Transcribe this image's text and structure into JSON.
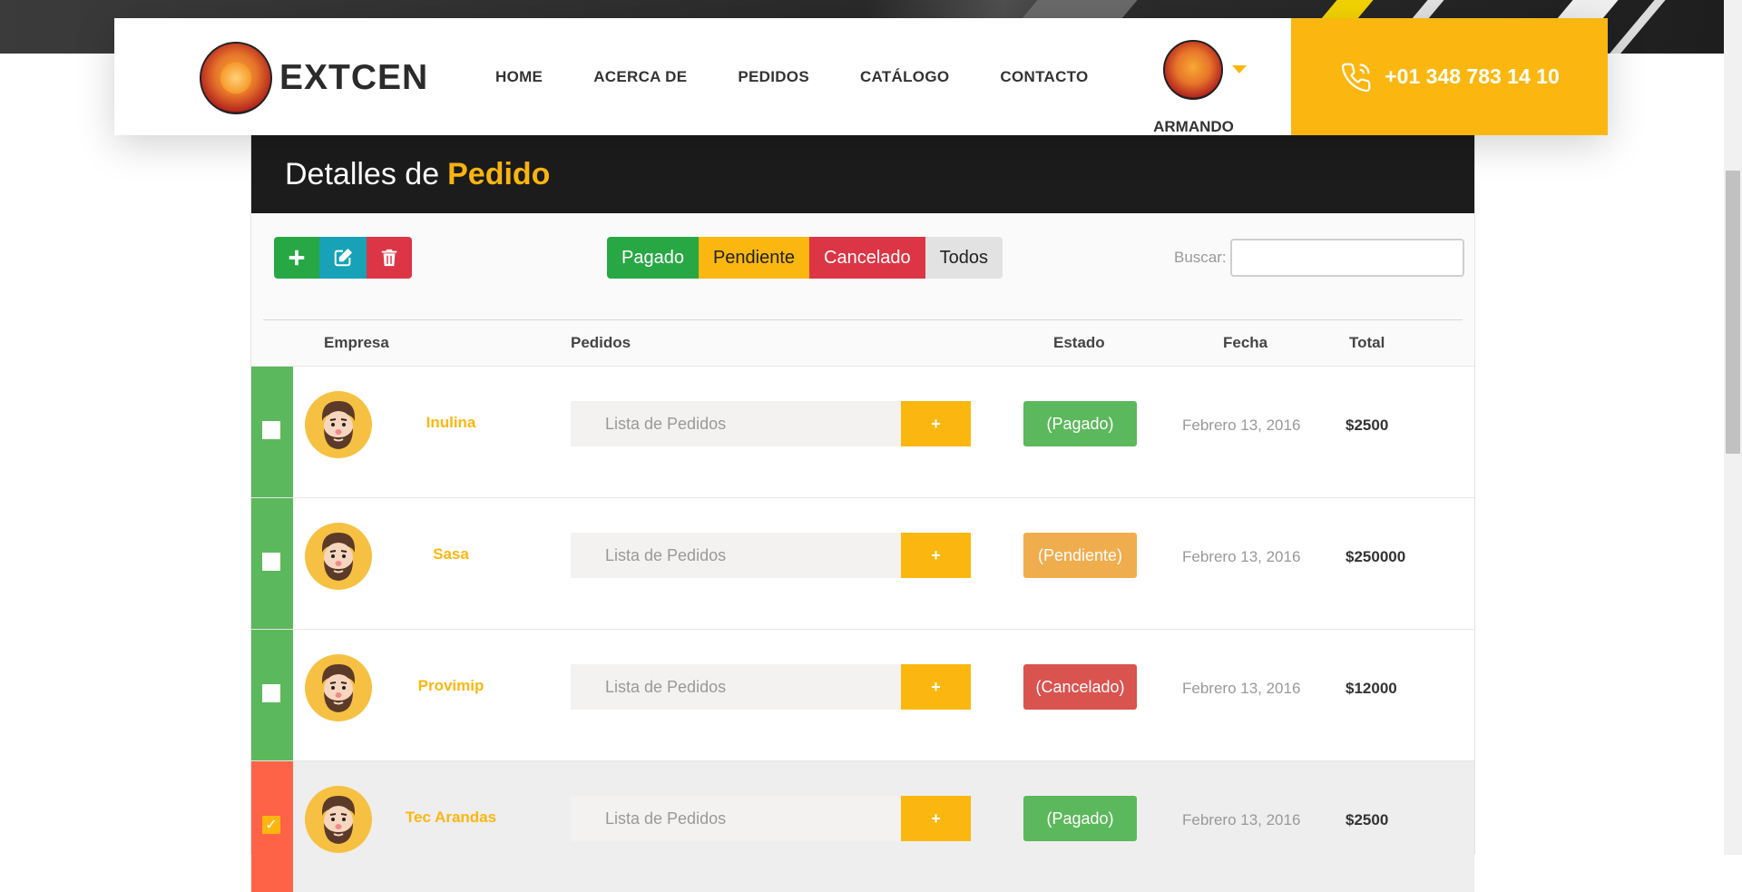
{
  "brand": {
    "name": "EXTCEN"
  },
  "nav": {
    "items": [
      {
        "label": "HOME"
      },
      {
        "label": "ACERCA DE"
      },
      {
        "label": "PEDIDOS"
      },
      {
        "label": "CATÁLOGO"
      },
      {
        "label": "CONTACTO"
      }
    ]
  },
  "user": {
    "name": "ARMANDO"
  },
  "phone": {
    "number": "+01 348 783 14 10"
  },
  "panel": {
    "title_prefix": "Detalles de",
    "title_accent": "Pedido"
  },
  "filters": {
    "paid": "Pagado",
    "pending": "Pendiente",
    "cancelled": "Cancelado",
    "all": "Todos"
  },
  "search": {
    "label": "Buscar:",
    "value": ""
  },
  "table": {
    "headers": {
      "company": "Empresa",
      "orders": "Pedidos",
      "status": "Estado",
      "date": "Fecha",
      "total": "Total"
    },
    "rows": [
      {
        "company": "Inulina",
        "orders_placeholder": "Lista de Pedidos",
        "add_label": "+",
        "status": "(Pagado)",
        "status_color": "#5cb85c",
        "strip_color": "#5cb85c",
        "checked": false,
        "check_mark": "",
        "date": "Febrero 13, 2016",
        "total": "$2500"
      },
      {
        "company": "Sasa",
        "orders_placeholder": "Lista de Pedidos",
        "add_label": "+",
        "status": "(Pendiente)",
        "status_color": "#f0ad4e",
        "strip_color": "#5cb85c",
        "checked": false,
        "check_mark": "",
        "date": "Febrero 13, 2016",
        "total": "$250000"
      },
      {
        "company": "Provimip",
        "orders_placeholder": "Lista de Pedidos",
        "add_label": "+",
        "status": "(Cancelado)",
        "status_color": "#d9534f",
        "strip_color": "#5cb85c",
        "checked": false,
        "check_mark": "",
        "date": "Febrero 13, 2016",
        "total": "$12000"
      },
      {
        "company": "Tec Arandas",
        "orders_placeholder": "Lista de Pedidos",
        "add_label": "+",
        "status": "(Pagado)",
        "status_color": "#5cb85c",
        "strip_color": "#ff6347",
        "checked": true,
        "check_mark": "✓",
        "date": "Febrero 13, 2016",
        "total": "$2500"
      }
    ]
  },
  "colors": {
    "accent": "#fbb710",
    "dark": "#1c1c1c",
    "green": "#28a745",
    "teal": "#17a2b8",
    "red": "#dc3545"
  },
  "icons": {
    "add": "plus-icon",
    "edit": "edit-icon",
    "delete": "trash-icon",
    "phone": "phone-icon",
    "avatar": "bearded-man-avatar-icon",
    "caret": "caret-down-icon"
  }
}
